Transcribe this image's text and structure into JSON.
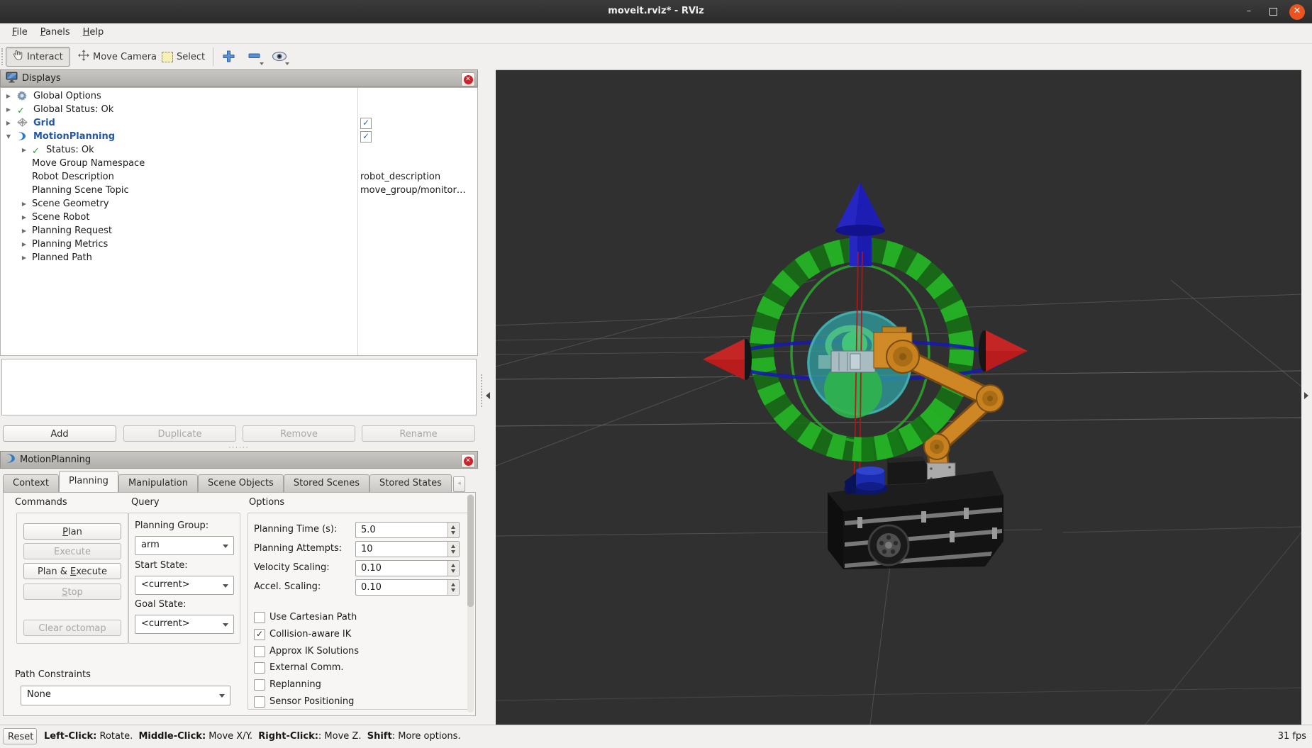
{
  "window": {
    "title": "moveit.rviz* - RViz"
  },
  "menu": {
    "items": [
      {
        "pre": "",
        "u": "F",
        "post": "ile"
      },
      {
        "pre": "",
        "u": "P",
        "post": "anels"
      },
      {
        "pre": "",
        "u": "H",
        "post": "elp"
      }
    ]
  },
  "toolbar": {
    "interact": "Interact",
    "move_camera": "Move Camera",
    "select": "Select"
  },
  "displays": {
    "title": "Displays",
    "rows": [
      {
        "depth": 0,
        "exp": "right",
        "icon": "gear",
        "label": "Global Options"
      },
      {
        "depth": 0,
        "exp": "right",
        "icon": "check",
        "label": "Global Status: Ok"
      },
      {
        "depth": 0,
        "exp": "right",
        "icon": "grid",
        "label": "Grid",
        "emph": true,
        "checked": true
      },
      {
        "depth": 0,
        "exp": "down",
        "icon": "motion",
        "label": "MotionPlanning",
        "emph": true,
        "checked": true
      },
      {
        "depth": 1,
        "exp": "right",
        "icon": "check",
        "label": "Status: Ok"
      },
      {
        "depth": 1,
        "exp": null,
        "icon": null,
        "label": "Move Group Namespace"
      },
      {
        "depth": 1,
        "exp": null,
        "icon": null,
        "label": "Robot Description",
        "value": "robot_description"
      },
      {
        "depth": 1,
        "exp": null,
        "icon": null,
        "label": "Planning Scene Topic",
        "value": "move_group/monitor…"
      },
      {
        "depth": 1,
        "exp": "right",
        "icon": null,
        "label": "Scene Geometry"
      },
      {
        "depth": 1,
        "exp": "right",
        "icon": null,
        "label": "Scene Robot"
      },
      {
        "depth": 1,
        "exp": "right",
        "icon": null,
        "label": "Planning Request"
      },
      {
        "depth": 1,
        "exp": "right",
        "icon": null,
        "label": "Planning Metrics"
      },
      {
        "depth": 1,
        "exp": "right",
        "icon": null,
        "label": "Planned Path"
      }
    ],
    "buttons": [
      {
        "name": "add",
        "label": "Add",
        "enabled": true
      },
      {
        "name": "duplicate",
        "label": "Duplicate",
        "enabled": false
      },
      {
        "name": "remove",
        "label": "Remove",
        "enabled": false
      },
      {
        "name": "rename",
        "label": "Rename",
        "enabled": false
      }
    ]
  },
  "motion_planning": {
    "title": "MotionPlanning",
    "tabs": [
      {
        "label": "Context"
      },
      {
        "label": "Planning",
        "active": true
      },
      {
        "label": "Manipulation"
      },
      {
        "label": "Scene Objects"
      },
      {
        "label": "Stored Scenes"
      },
      {
        "label": "Stored States"
      }
    ],
    "commands": {
      "heading": "Commands",
      "buttons": [
        {
          "name": "plan",
          "pre": "",
          "u": "P",
          "post": "lan",
          "enabled": true
        },
        {
          "name": "execute",
          "pre": "Execute",
          "u": "",
          "post": "",
          "enabled": false
        },
        {
          "name": "plan-and-execute",
          "pre": "Plan & ",
          "u": "E",
          "post": "xecute",
          "enabled": true
        },
        {
          "name": "stop",
          "pre": "",
          "u": "S",
          "post": "top",
          "enabled": false
        },
        {
          "name": "clear-octomap",
          "pre": "Clear octomap",
          "u": "",
          "post": "",
          "enabled": false
        }
      ]
    },
    "query": {
      "heading": "Query",
      "planning_group_label": "Planning Group:",
      "planning_group_value": "arm",
      "start_state_label": "Start State:",
      "start_state_value": "<current>",
      "goal_state_label": "Goal State:",
      "goal_state_value": "<current>"
    },
    "options": {
      "heading": "Options",
      "fields": [
        {
          "label": "Planning Time (s):",
          "value": "5.0"
        },
        {
          "label": "Planning Attempts:",
          "value": "10"
        },
        {
          "label": "Velocity Scaling:",
          "value": "0.10"
        },
        {
          "label": "Accel. Scaling:",
          "value": "0.10"
        }
      ],
      "checkboxes": [
        {
          "label": "Use Cartesian Path",
          "checked": false
        },
        {
          "label": "Collision-aware IK",
          "checked": true
        },
        {
          "label": "Approx IK Solutions",
          "checked": false
        },
        {
          "label": "External Comm.",
          "checked": false
        },
        {
          "label": "Replanning",
          "checked": false
        },
        {
          "label": "Sensor Positioning",
          "checked": false
        }
      ]
    },
    "path_constraints": {
      "label": "Path Constraints",
      "value": "None"
    }
  },
  "statusbar": {
    "reset": "Reset",
    "segments": [
      {
        "text": "Left-Click:",
        "bold": true
      },
      {
        "text": " Rotate.  ",
        "bold": false
      },
      {
        "text": "Middle-Click:",
        "bold": true
      },
      {
        "text": " Move X/Y.  ",
        "bold": false
      },
      {
        "text": "Right-Click:",
        "bold": true
      },
      {
        "text": ": Move Z.  ",
        "bold": false
      },
      {
        "text": "Shift",
        "bold": true
      },
      {
        "text": ": More options.",
        "bold": false
      }
    ],
    "fps": "31 fps"
  },
  "colors": {
    "accent_blue": "#2457a4",
    "viewport_bg": "#303030",
    "marker_green": "#27b427",
    "marker_blue": "#1b1bb0",
    "marker_red": "#b81c1c",
    "robot_orange": "#cf8726",
    "close_red": "#cc2229",
    "titlebar_close_orange": "#e95420"
  }
}
